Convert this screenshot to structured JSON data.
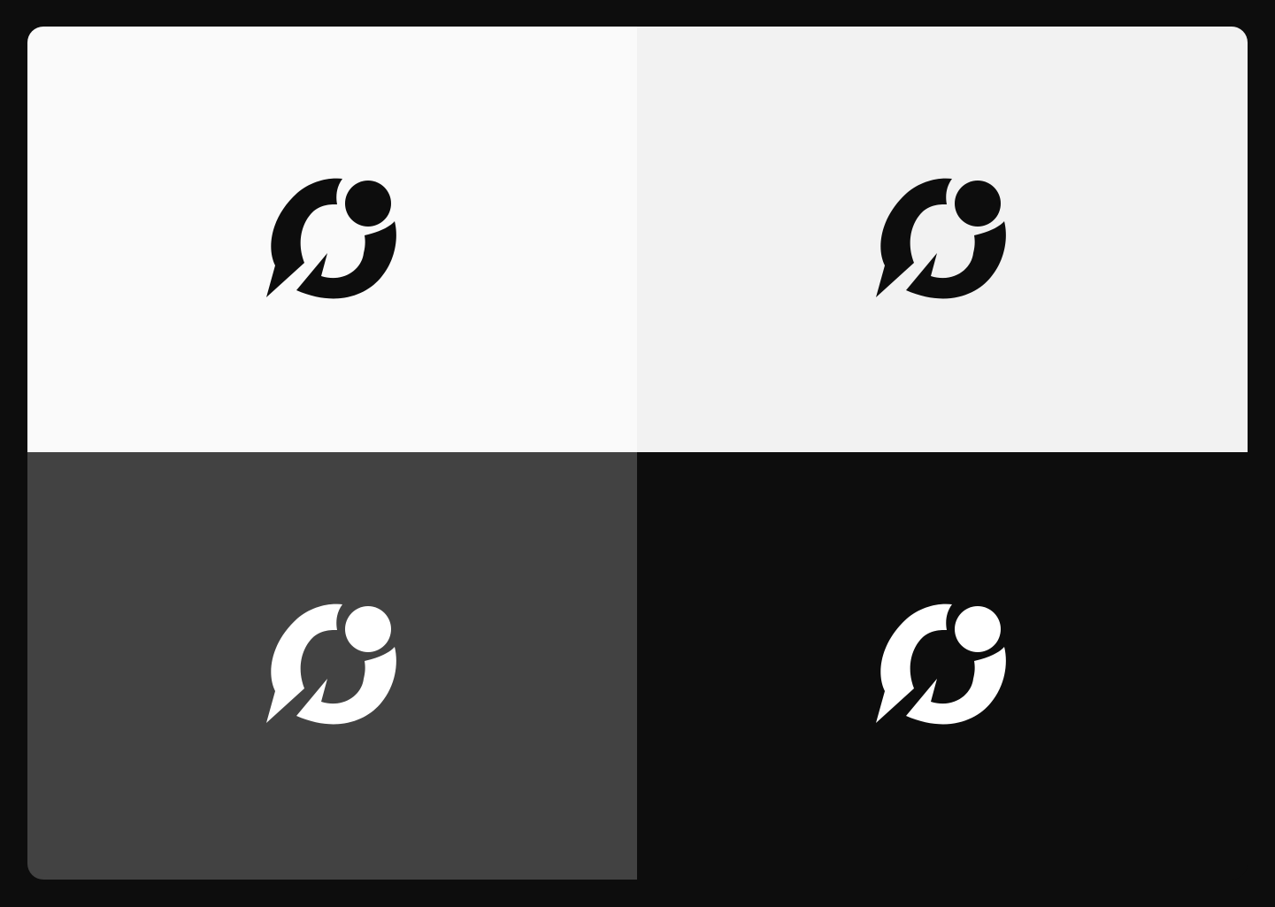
{
  "swatches": [
    {
      "id": "white",
      "background": "#fafafa",
      "logo_color": "#0d0d0d"
    },
    {
      "id": "light-gray",
      "background": "#f2f2f2",
      "logo_color": "#0d0d0d"
    },
    {
      "id": "dark-gray",
      "background": "#424242",
      "logo_color": "#ffffff"
    },
    {
      "id": "black",
      "background": "#0d0d0d",
      "logo_color": "#ffffff"
    }
  ],
  "logo": {
    "icon": "speech-bubble-info-logo"
  }
}
